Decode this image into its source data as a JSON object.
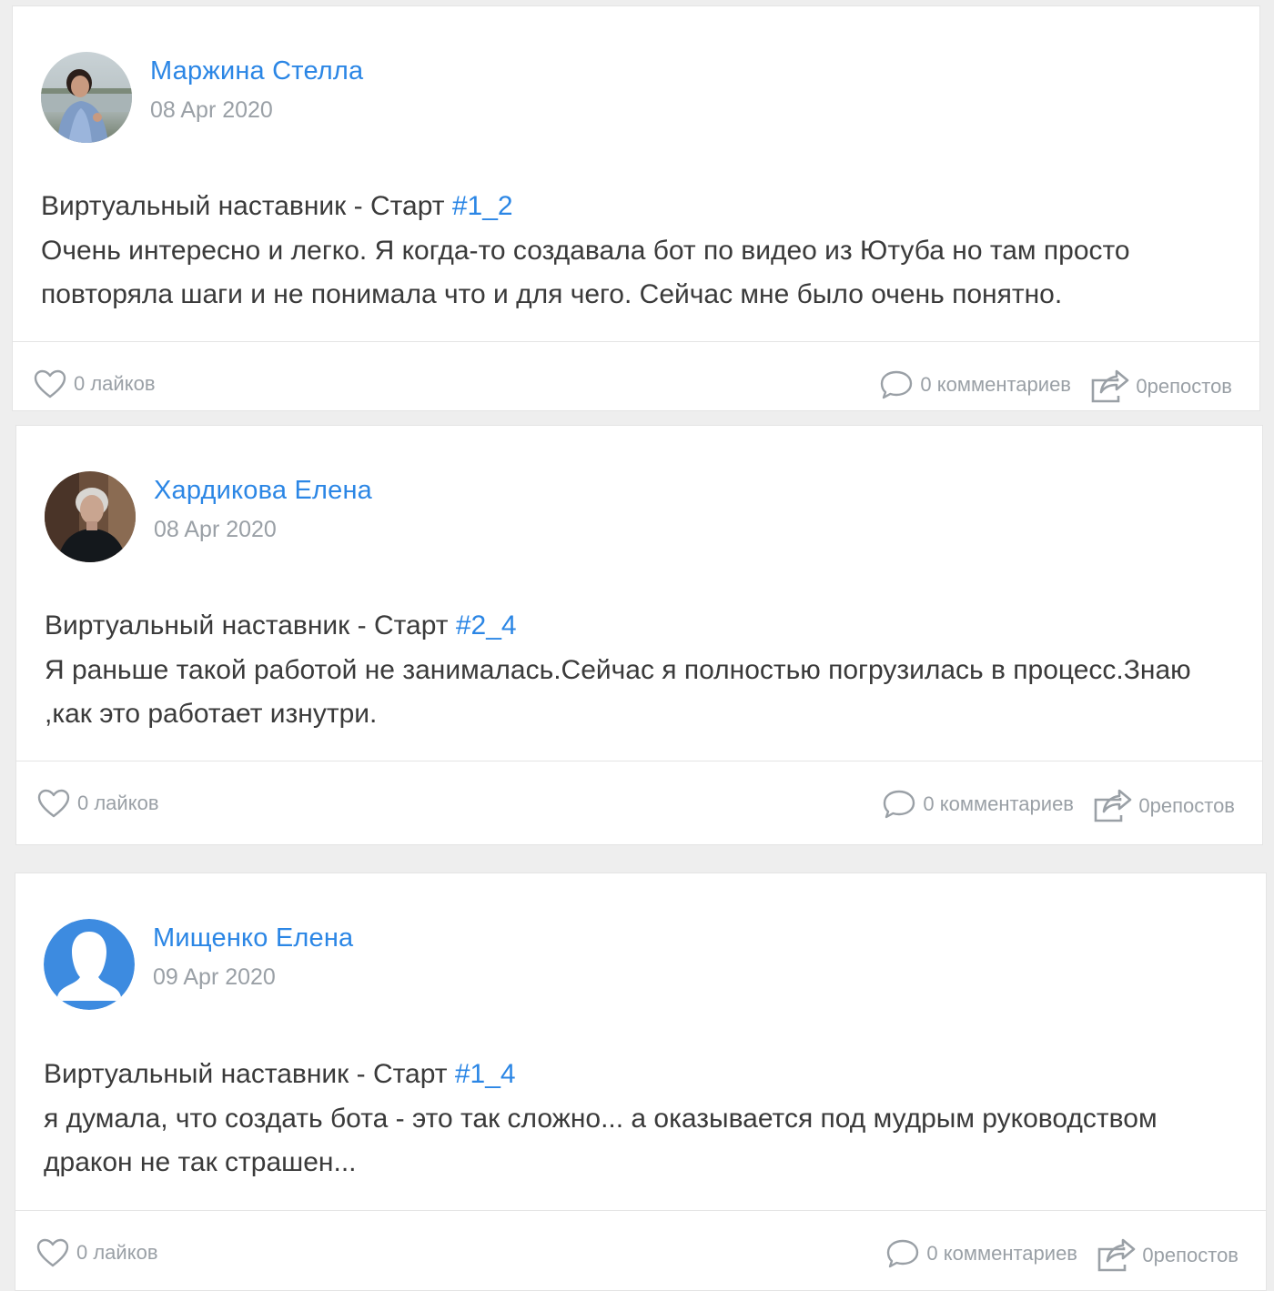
{
  "posts": [
    {
      "author": "Маржина Стелла",
      "date": "08 Apr 2020",
      "line1_prefix": "Виртуальный наставник - Старт ",
      "tag": "#1_2",
      "text": "Очень интересно и легко. Я когда-то создавала бот по видео из Ютуба но там просто повторяла шаги и не понимала что и для чего. Сейчас мне было очень понятно.",
      "likes": "0 лайков",
      "comments": "0 комментариев",
      "reposts": "0репостов",
      "avatar": "photo-woman-outdoors"
    },
    {
      "author": "Хардикова Елена",
      "date": "08 Apr 2020",
      "line1_prefix": "Виртуальный наставник - Старт ",
      "tag": "#2_4",
      "text": "Я раньше такой работой не занималась.Сейчас я полностью погрузилась в процесс.Знаю ,как это работает изнутри.",
      "likes": "0 лайков",
      "comments": "0 комментариев",
      "reposts": "0репостов",
      "avatar": "photo-woman-grey-hair"
    },
    {
      "author": "Мищенко Елена",
      "date": "09 Apr 2020",
      "line1_prefix": "Виртуальный наставник - Старт ",
      "tag": "#1_4",
      "text": "я думала, что создать бота - это так сложно... а оказывается под мудрым руководством дракон не так страшен...",
      "likes": "0 лайков",
      "comments": "0 комментариев",
      "reposts": "0репостов",
      "avatar": "default-user-silhouette"
    }
  ],
  "colors": {
    "accent": "#2b86e5",
    "muted": "#9aa0a6",
    "text": "#3a3a3a",
    "background": "#eeeeee"
  },
  "icons": {
    "likes": "heart-icon",
    "comments": "speech-bubble-icon",
    "reposts": "share-icon"
  }
}
